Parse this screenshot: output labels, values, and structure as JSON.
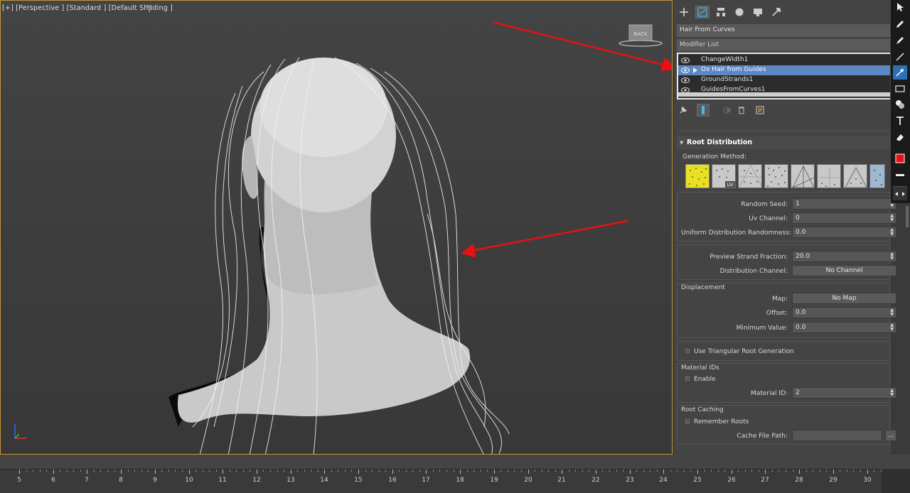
{
  "viewport": {
    "label": "[+] [Perspective ] [Standard ] [Default Shading ]",
    "viewcube_label": "BACK"
  },
  "command_panel": {
    "tabs": [
      "create-icon",
      "modify-icon",
      "hierarchy-icon",
      "motion-icon",
      "display-icon",
      "utilities-icon"
    ],
    "object_name": "Hair From Curves",
    "modifier_list_label": "Modifier List",
    "stack": [
      {
        "label": "ChangeWidth1",
        "selected": false,
        "has_arrow": false
      },
      {
        "label": "Ox Hair from Guides",
        "selected": true,
        "has_arrow": true
      },
      {
        "label": "GroundStrands1",
        "selected": false,
        "has_arrow": false
      },
      {
        "label": "GuidesFromCurves1",
        "selected": false,
        "has_arrow": false
      }
    ],
    "root_distribution": {
      "title": "Root Distribution",
      "generation_method_label": "Generation Method:",
      "random_seed_label": "Random Seed:",
      "random_seed_value": "1",
      "uv_channel_label": "Uv Channel:",
      "uv_channel_value": "0",
      "uniform_randomness_label": "Uniform Distribution Randomness:",
      "uniform_randomness_value": "0.0",
      "preview_fraction_label": "Preview Strand Fraction:",
      "preview_fraction_value": "20.0",
      "distribution_channel_label": "Distribution Channel:",
      "distribution_channel_value": "No Channel",
      "displacement_title": "Displacement",
      "map_label": "Map:",
      "map_value": "No Map",
      "offset_label": "Offset:",
      "offset_value": "0.0",
      "min_value_label": "Minimum Value:",
      "min_value_value": "0.0",
      "triangular_label": "Use Triangular Root Generation",
      "material_ids_title": "Material IDs",
      "enable_label": "Enable",
      "material_id_label": "Material ID:",
      "material_id_value": "2",
      "root_caching_title": "Root Caching",
      "remember_roots_label": "Remember Roots",
      "cache_path_label": "Cache File Path:",
      "browse_label": "..."
    }
  },
  "timeline": {
    "frames": [
      "5",
      "6",
      "7",
      "8",
      "9",
      "10",
      "11",
      "12",
      "13",
      "14",
      "15",
      "16",
      "17",
      "18",
      "19",
      "20",
      "21",
      "22",
      "23",
      "24",
      "25",
      "26",
      "27",
      "28",
      "29",
      "30"
    ]
  },
  "colors": {
    "viewport_border": "#c2963a",
    "selection_blue": "#5b87c4",
    "annotation_red": "#e81010",
    "active_method_yellow": "#e8e020"
  }
}
